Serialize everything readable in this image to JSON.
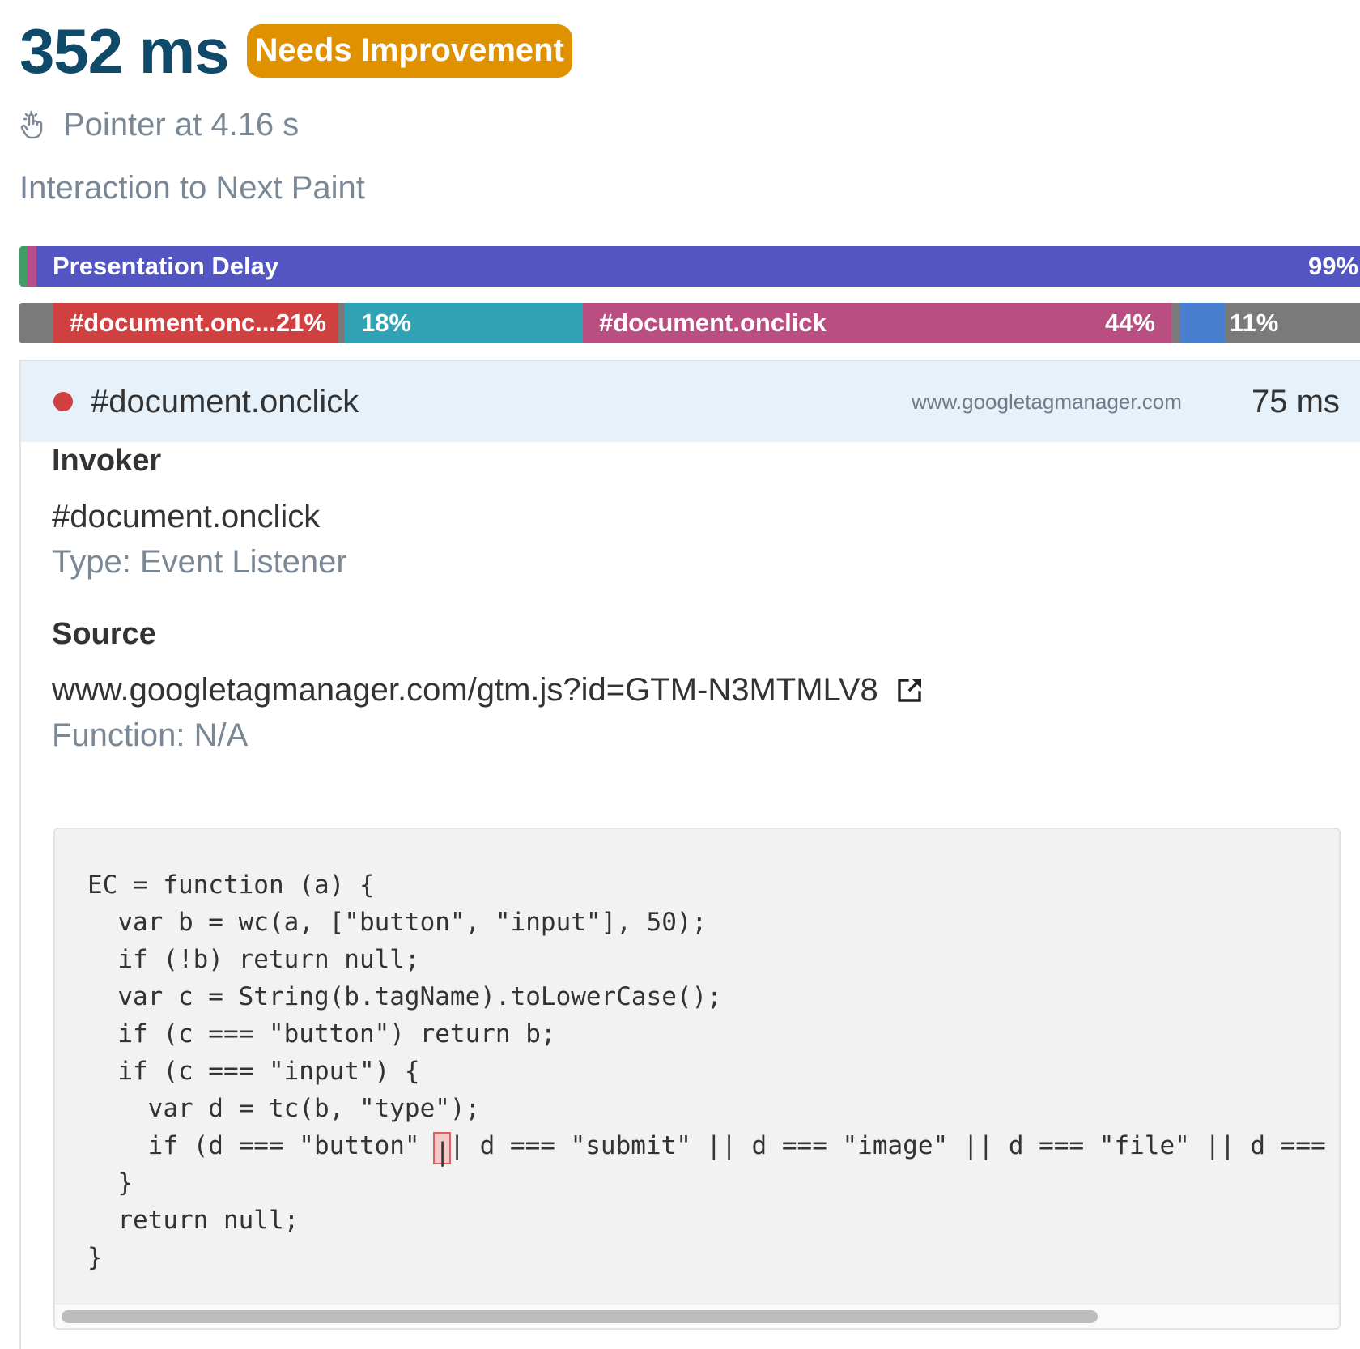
{
  "header": {
    "metric_value": "352 ms",
    "rating": "Needs Improvement"
  },
  "interaction": {
    "pointer_text": "Pointer at 4.16 s",
    "metric_name": "Interaction to Next Paint"
  },
  "phase_bar": {
    "label": "Presentation Delay",
    "percent": "99%",
    "colors": {
      "input_delay": "#3e9e63",
      "processing": "#b84f8a",
      "presentation": "#5356c2"
    }
  },
  "task_bar": {
    "segments": [
      {
        "label": "",
        "percent": "",
        "color": "#7a7a7a"
      },
      {
        "label": "#document.onc...",
        "percent": "21%",
        "color": "#cf4040"
      },
      {
        "label": "",
        "percent": "",
        "color": "#7a7a7a"
      },
      {
        "label": "",
        "percent": "18%",
        "color": "#2fa3b5"
      },
      {
        "label": "#document.onclick",
        "percent": "44%",
        "color": "#b84f80"
      },
      {
        "label": "",
        "percent": "",
        "color": "#7a7a7a"
      },
      {
        "label": "",
        "percent": "",
        "color": "#4a7fcf"
      },
      {
        "label": "",
        "percent": "11%",
        "color": "#7a7a7a"
      }
    ]
  },
  "detail": {
    "title": "#document.onclick",
    "domain": "www.googletagmanager.com",
    "duration": "75 ms",
    "invoker_label": "Invoker",
    "invoker_value": "#document.onclick",
    "invoker_type": "Type: Event Listener",
    "source_label": "Source",
    "source_url": "www.googletagmanager.com/gtm.js?id=GTM-N3MTMLV8",
    "source_function": "Function: N/A"
  },
  "code": {
    "before_cursor": "EC = function (a) {\n  var b = wc(a, [\"button\", \"input\"], 50);\n  if (!b) return null;\n  var c = String(b.tagName).toLowerCase();\n  if (c === \"button\") return b;\n  if (c === \"input\") {\n    var d = tc(b, \"type\");\n    if (d === \"button\" ",
    "cursor_char": "|",
    "after_cursor": "| d === \"submit\" || d === \"image\" || d === \"file\" || d === \"",
    "tail": "\n  }\n  return null;\n}"
  }
}
